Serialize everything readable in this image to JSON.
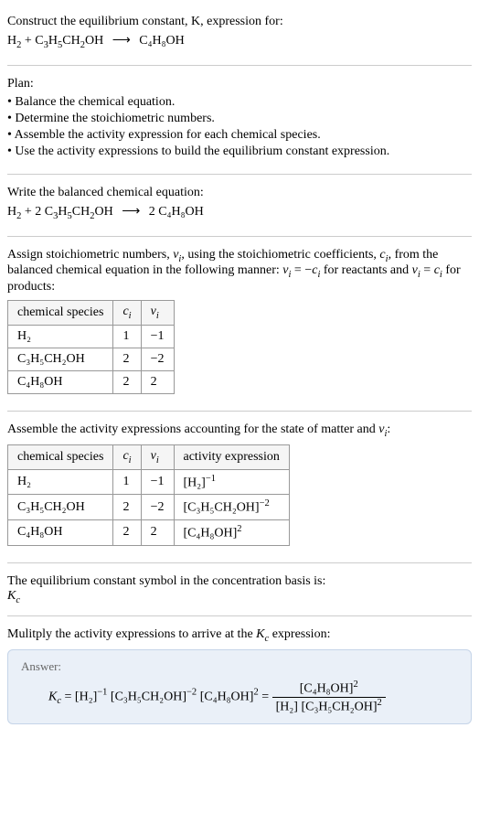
{
  "header": {
    "prompt": "Construct the equilibrium constant, K, expression for:",
    "equation_lhs_h2": "H",
    "equation_lhs_h2_sub": "2",
    "equation_plus1": " + ",
    "equation_lhs_c3h5": "C",
    "equation_lhs_c3h5_3": "3",
    "equation_lhs_c3h5_h": "H",
    "equation_lhs_c3h5_5": "5",
    "equation_lhs_ch2": "CH",
    "equation_lhs_ch2_2": "2",
    "equation_lhs_oh": "OH",
    "equation_arrow": "⟶",
    "equation_rhs": "C₄H₈OH"
  },
  "plan": {
    "heading": "Plan:",
    "b1": "• Balance the chemical equation.",
    "b2": "• Determine the stoichiometric numbers.",
    "b3": "• Assemble the activity expression for each chemical species.",
    "b4": "• Use the activity expressions to build the equilibrium constant expression."
  },
  "balanced": {
    "heading": "Write the balanced chemical equation:",
    "h2": "H",
    "h2_sub": "2",
    "plus": " + 2 ",
    "c3h5": "C",
    "c3h5_3": "3",
    "c3h5_h": "H",
    "c3h5_5": "5",
    "ch2": "CH",
    "ch2_2": "2",
    "oh": "OH",
    "arrow": "⟶",
    "rhs_coef": " 2 ",
    "rhs": "C₄H₈OH"
  },
  "stoich": {
    "text1": "Assign stoichiometric numbers, ",
    "nu_i": "ν",
    "nu_sub": "i",
    "text2": ", using the stoichiometric coefficients, ",
    "c_i": "c",
    "c_sub": "i",
    "text3": ", from the balanced chemical equation in the following manner: ",
    "rel1": "ν",
    "rel1_sub": "i",
    "rel1_eq": " = −",
    "rel1_c": "c",
    "rel1_csub": "i",
    "text4": " for reactants and ",
    "rel2": "ν",
    "rel2_sub": "i",
    "rel2_eq": " = ",
    "rel2_c": "c",
    "rel2_csub": "i",
    "text5": " for products:",
    "table": {
      "h1": "chemical species",
      "h2": "c",
      "h2_sub": "i",
      "h3": "ν",
      "h3_sub": "i",
      "r1c1": "H₂",
      "r1c2": "1",
      "r1c3": "−1",
      "r2c1": "C₃H₅CH₂OH",
      "r2c2": "2",
      "r2c3": "−2",
      "r3c1": "C₄H₈OH",
      "r3c2": "2",
      "r3c3": "2"
    }
  },
  "activity": {
    "heading1": "Assemble the activity expressions accounting for the state of matter and ",
    "nu": "ν",
    "nu_sub": "i",
    "heading2": ":",
    "table": {
      "h1": "chemical species",
      "h2": "c",
      "h2_sub": "i",
      "h3": "ν",
      "h3_sub": "i",
      "h4": "activity expression",
      "r1c1": "H₂",
      "r1c2": "1",
      "r1c3": "−1",
      "r1c4_base": "[H₂]",
      "r1c4_exp": "−1",
      "r2c1": "C₃H₅CH₂OH",
      "r2c2": "2",
      "r2c3": "−2",
      "r2c4_base": "[C₃H₅CH₂OH]",
      "r2c4_exp": "−2",
      "r3c1": "C₄H₈OH",
      "r3c2": "2",
      "r3c3": "2",
      "r3c4_base": "[C₄H₈OH]",
      "r3c4_exp": "2"
    }
  },
  "symbol": {
    "heading": "The equilibrium constant symbol in the concentration basis is:",
    "kc": "K",
    "kc_sub": "c"
  },
  "multiply": {
    "heading": "Mulitply the activity expressions to arrive at the ",
    "kc": "K",
    "kc_sub": "c",
    "heading2": " expression:"
  },
  "answer": {
    "label": "Answer:",
    "kc": "K",
    "kc_sub": "c",
    "eq": " = ",
    "t1_base": "[H₂]",
    "t1_exp": "−1",
    "sp1": " ",
    "t2_base": "[C₃H₅CH₂OH]",
    "t2_exp": "−2",
    "sp2": " ",
    "t3_base": "[C₄H₈OH]",
    "t3_exp": "2",
    "eq2": " = ",
    "num_base": "[C₄H₈OH]",
    "num_exp": "2",
    "den1_base": "[H₂]",
    "den_sp": " ",
    "den2_base": "[C₃H₅CH₂OH]",
    "den2_exp": "2"
  }
}
